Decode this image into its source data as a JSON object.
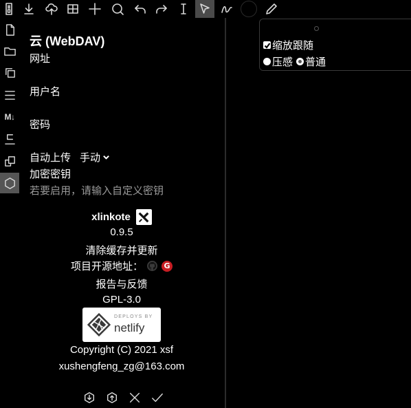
{
  "toolbar": {
    "tools": [
      "save-icon",
      "download-icon",
      "cloud-upload-icon",
      "table-icon",
      "plus-icon",
      "search-icon",
      "undo-icon",
      "redo-icon",
      "text-cursor-icon",
      "select-pointer-icon",
      "pen-squiggle-icon",
      "color-picker",
      "pencil-icon"
    ],
    "active_tool": "select-pointer-icon",
    "brush_color": "#000000"
  },
  "sidebar": {
    "items": [
      "new-file-icon",
      "folder-icon",
      "copy-multi-icon",
      "list-icon",
      "markdown-icon",
      "outline-icon",
      "duplicate-icon",
      "cube-icon"
    ],
    "markdown_text": "M↓",
    "active_item": "cube-icon"
  },
  "panel": {
    "title": "云 (WebDAV)",
    "url_label": "网址",
    "username_label": "用户名",
    "password_label": "密码",
    "auto_upload_label": "自动上传",
    "auto_upload_value": "手动",
    "encrypt_label": "加密密钥",
    "encrypt_hint": "若要启用，请输入自定义密钥"
  },
  "about": {
    "app_name": "xlinkote",
    "version": "0.9.5",
    "clear_cache": "清除缓存并更新",
    "repo_label": "项目开源地址：",
    "gitee_letter": "G",
    "report": "报告与反馈",
    "license": "GPL-3.0",
    "netlify_small": "DEPLOYS BY",
    "netlify_big": "netlify",
    "copyright": "Copyright (C) 2021 xsf",
    "email": "xushengfeng_zg@163.com"
  },
  "bottom_actions": [
    "download-circle-icon",
    "upload-circle-icon",
    "close-icon",
    "check-icon"
  ],
  "popup": {
    "zoom_follow_label": "缩放跟随",
    "zoom_follow_checked": true,
    "pressure_label": "压感",
    "normal_label": "普通",
    "selected_mode": "普通"
  }
}
